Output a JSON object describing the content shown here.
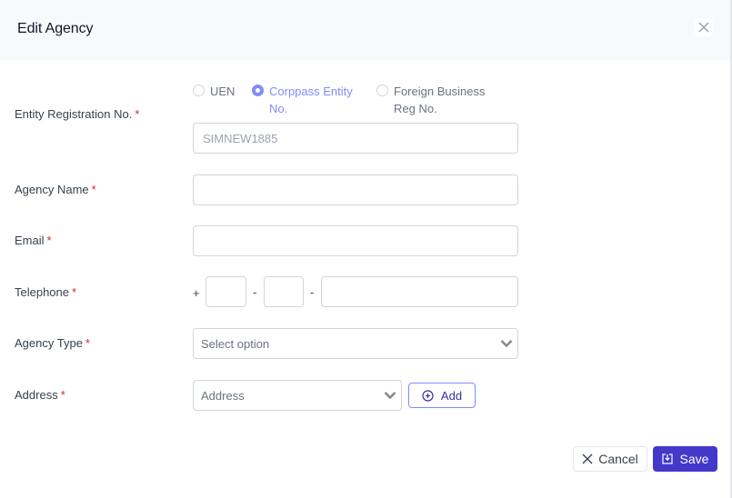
{
  "modal": {
    "title": "Edit Agency",
    "close_icon": "close-icon"
  },
  "form": {
    "required_marker": "*",
    "entity_registration": {
      "label": "Entity Registration No.",
      "options": [
        {
          "label_line1": "UEN",
          "label_line2": "",
          "checked": false
        },
        {
          "label_line1": "Corppass Entity",
          "label_line2": "No.",
          "checked": true
        },
        {
          "label_line1": "Foreign Business",
          "label_line2": "Reg No.",
          "checked": false
        }
      ],
      "value": "SIMNEW1885"
    },
    "agency_name": {
      "label": "Agency Name",
      "value": ""
    },
    "email": {
      "label": "Email",
      "value": ""
    },
    "telephone": {
      "label": "Telephone",
      "prefix": "+",
      "separator": "-",
      "country_code": "",
      "area_code": "",
      "number": ""
    },
    "agency_type": {
      "label": "Agency Type",
      "placeholder": "Select option"
    },
    "address": {
      "label": "Address",
      "placeholder": "Address",
      "add_label": "Add",
      "add_icon": "plus-circle-icon"
    }
  },
  "footer": {
    "cancel_label": "Cancel",
    "cancel_icon": "close-icon",
    "save_label": "Save",
    "save_icon": "save-icon"
  },
  "colors": {
    "primary": "#4338ca",
    "accent": "#818cf8",
    "required": "#dc2626"
  }
}
